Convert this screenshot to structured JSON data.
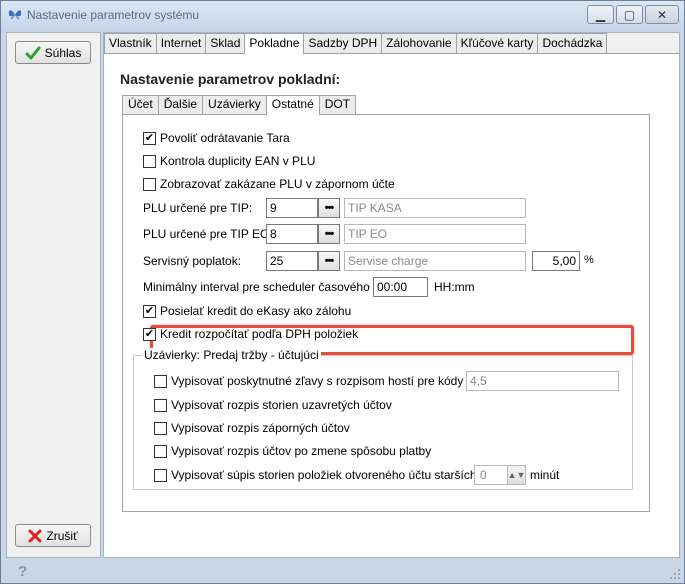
{
  "window": {
    "title": "Nastavenie parametrov systému",
    "minimize": "▁",
    "maximize": "▢",
    "close": "✕"
  },
  "left": {
    "ok_label": "Súhlas",
    "cancel_label": "Zrušiť"
  },
  "tabs": [
    "Vlastník",
    "Internet",
    "Sklad",
    "Pokladne",
    "Sadzby DPH",
    "Zálohovanie",
    "Kľúčové karty",
    "Dochádzka"
  ],
  "active_tab": "Pokladne",
  "section": {
    "title": "Nastavenie parametrov pokladní:",
    "subtabs": [
      "Účet",
      "Ďalšie",
      "Uzávierky",
      "Ostatné",
      "DOT"
    ],
    "active_subtab": "Ostatné"
  },
  "form": {
    "cb_tara": "Povoliť odrátavanie Tara",
    "cb_ean": "Kontrola duplicity EAN v PLU",
    "cb_zakazane": "Zobrazovať zakázane PLU v zápornom účte",
    "plu_tip_label": "PLU určené pre TIP:",
    "plu_tip_value": "9",
    "plu_tip_name": "TIP KASA",
    "plu_tipeo_label": "PLU určené pre TIP EO:",
    "plu_tipeo_value": "8",
    "plu_tipeo_name": "TIP EO",
    "servis_label": "Servisný poplatok:",
    "servis_value": "25",
    "servis_name": "Servise charge",
    "servis_percent": "5,00",
    "percent_sign": "%",
    "interval_label": "Minimálny interval pre scheduler časového PLU:",
    "interval_value": "00:00",
    "interval_unit": "HH:mm",
    "cb_kredit_zaloha": "Posielať kredit do eKasy ako zálohu",
    "cb_kredit_dph": "Kredit rozpočítať podľa DPH položiek",
    "dots": "•••"
  },
  "group": {
    "title": "Uzávierky: Predaj tržby - účtujúci",
    "item1": "Vypisovať poskytnutné zľavy s rozpisom hostí pre kódy zliav:",
    "item1_value": "4,5",
    "item2": "Vypisovať rozpis storien uzavretých účtov",
    "item3": "Vypisovať rozpis záporných účtov",
    "item4": "Vypisovať rozpis účtov po zmene spôsobu platby",
    "item5": "Vypisovať súpis storien položiek otvoreného účtu starších ako",
    "item5_value": "0",
    "item5_unit": "minút"
  },
  "checks": {
    "tara": true,
    "ean": false,
    "zakazane": false,
    "kredit_zaloha": true,
    "kredit_dph": true,
    "g1": false,
    "g2": false,
    "g3": false,
    "g4": false,
    "g5": false
  },
  "status": {
    "help": "?"
  },
  "colors": {
    "highlight": "#e74c3c",
    "check_green": "#2e9e2e",
    "cancel_red": "#d9241c"
  }
}
